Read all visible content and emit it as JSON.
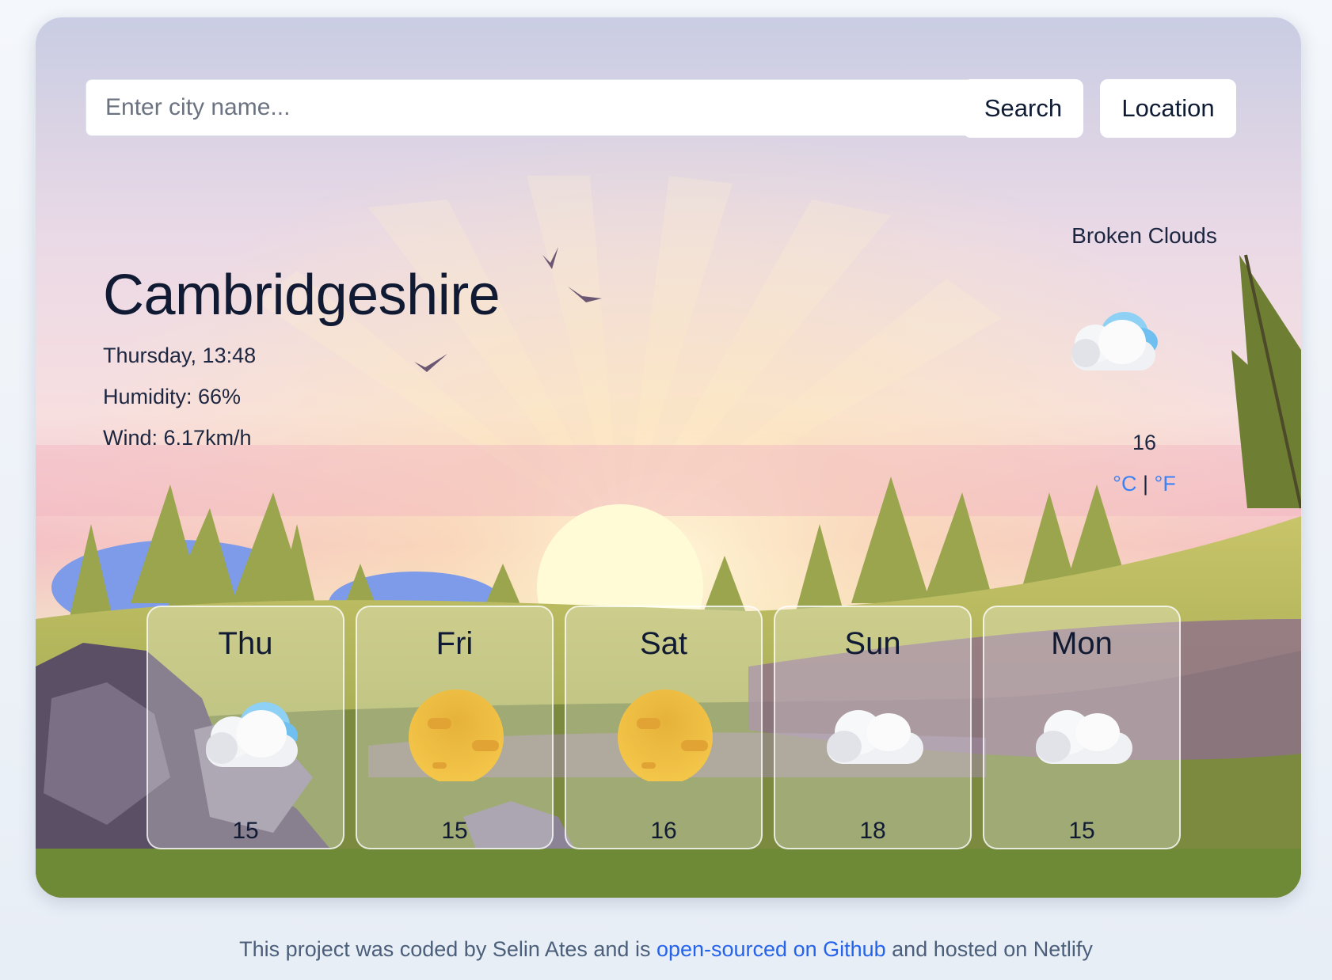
{
  "search": {
    "placeholder": "Enter city name...",
    "button": "Search",
    "location_button": "Location"
  },
  "current": {
    "city": "Cambridgeshire",
    "datetime": "Thursday, 13:48",
    "humidity": "Humidity: 66%",
    "wind": "Wind: 6.17km/h",
    "description": "Broken Clouds",
    "icon": "broken-clouds-icon",
    "temperature": "16",
    "unit_c": "°C",
    "unit_sep": "|",
    "unit_f": "°F"
  },
  "forecast": [
    {
      "day": "Thu",
      "temp": "15",
      "icon": "broken-clouds-icon"
    },
    {
      "day": "Fri",
      "temp": "15",
      "icon": "sun-icon"
    },
    {
      "day": "Sat",
      "temp": "16",
      "icon": "sun-icon"
    },
    {
      "day": "Sun",
      "temp": "18",
      "icon": "cloud-icon"
    },
    {
      "day": "Mon",
      "temp": "15",
      "icon": "cloud-icon"
    }
  ],
  "footer": {
    "prefix": "This project was coded by Selin Ates and is ",
    "link": "open-sourced on Github",
    "suffix": " and hosted on Netlify"
  },
  "colors": {
    "link": "#2563eb",
    "unit": "#3b82f6"
  }
}
